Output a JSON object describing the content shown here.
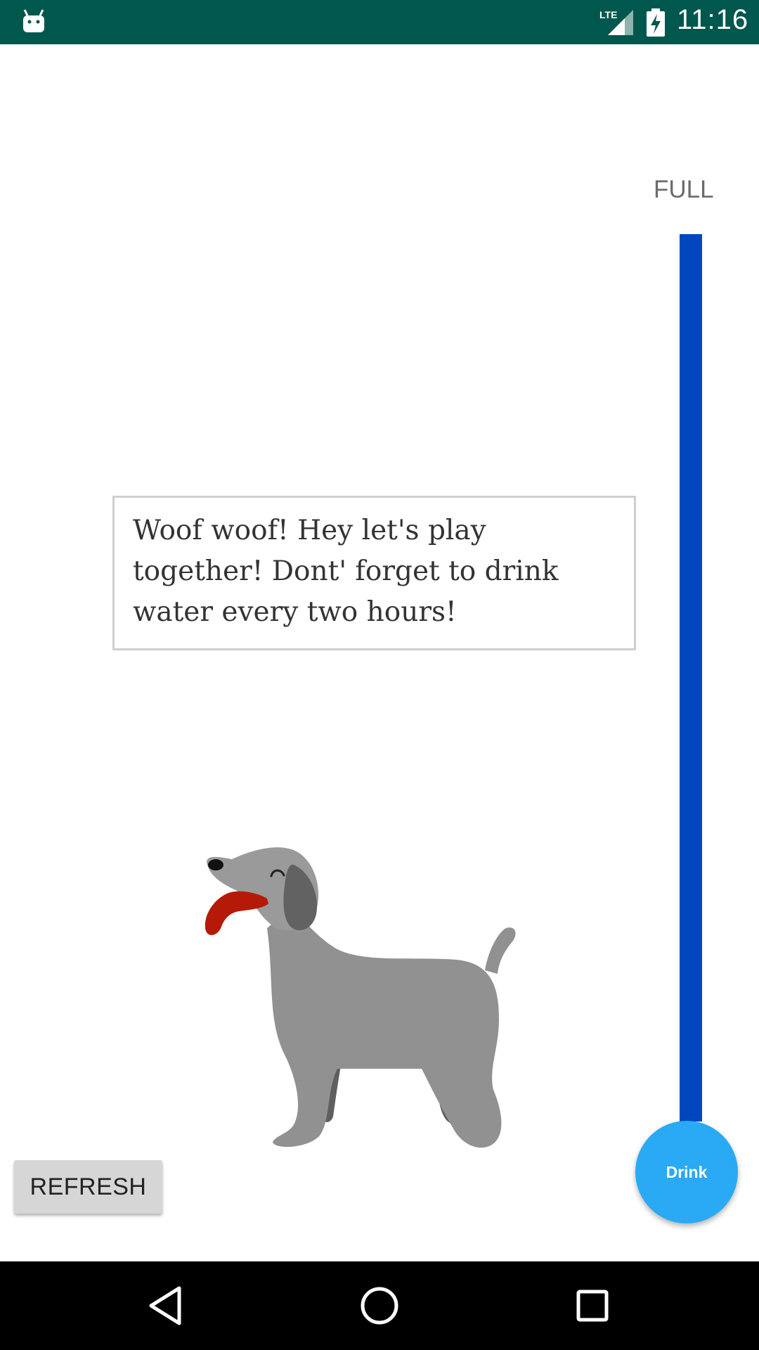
{
  "status_bar": {
    "time": "11:16",
    "network": "LTE",
    "icons": [
      "android-icon",
      "lte-signal-icon",
      "battery-charging-icon"
    ],
    "background": "#00574e"
  },
  "meter": {
    "label": "FULL",
    "level_fraction": 1.0,
    "fill_color": "#0047bd"
  },
  "speech": {
    "message": "Woof woof! Hey let's play together! Dont' forget to drink water every two hours!"
  },
  "dog": {
    "icon": "dog-illustration"
  },
  "buttons": {
    "refresh_label": "REFRESH",
    "drink_label": "Drink",
    "drink_color": "#2aa9f4"
  },
  "nav_bar": {
    "icons": [
      "back-icon",
      "home-icon",
      "recents-icon"
    ]
  }
}
